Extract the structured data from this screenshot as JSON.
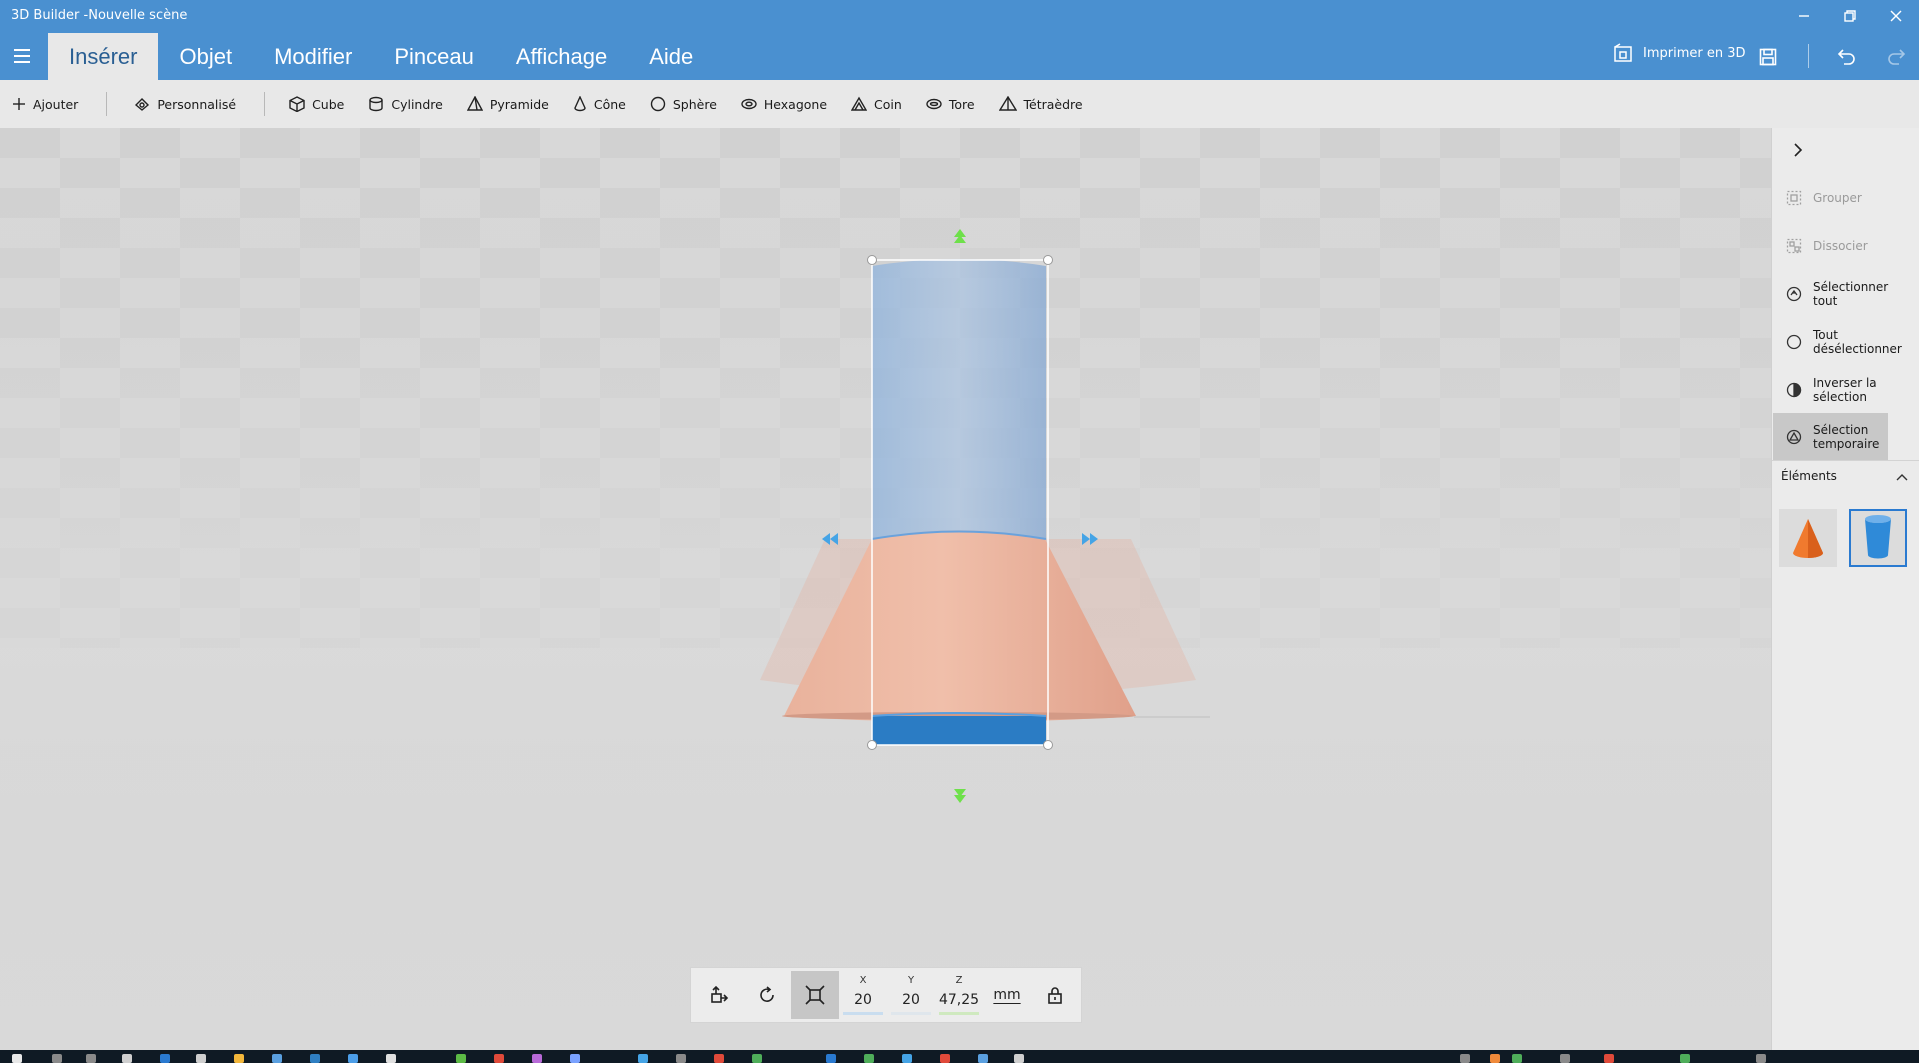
{
  "window": {
    "title": "3D Builder -Nouvelle scène",
    "controls": [
      "minimize-icon",
      "restore-icon",
      "close-icon"
    ]
  },
  "tabs": [
    {
      "label": "Insérer",
      "active": true
    },
    {
      "label": "Objet",
      "active": false
    },
    {
      "label": "Modifier",
      "active": false
    },
    {
      "label": "Pinceau",
      "active": false
    },
    {
      "label": "Affichage",
      "active": false
    },
    {
      "label": "Aide",
      "active": false
    }
  ],
  "toolbar": {
    "print_label": "Imprimer en 3D",
    "icons": [
      "print-3d-icon",
      "save-icon",
      "undo-icon",
      "redo-icon"
    ]
  },
  "ribbon": {
    "add_label": "Ajouter",
    "custom_label": "Personnalisé",
    "shapes": [
      {
        "label": "Cube",
        "icon": "cube-icon"
      },
      {
        "label": "Cylindre",
        "icon": "cylinder-icon"
      },
      {
        "label": "Pyramide",
        "icon": "pyramid-icon"
      },
      {
        "label": "Cône",
        "icon": "cone-icon"
      },
      {
        "label": "Sphère",
        "icon": "sphere-icon"
      },
      {
        "label": "Hexagone",
        "icon": "hexagon-icon"
      },
      {
        "label": "Coin",
        "icon": "wedge-icon"
      },
      {
        "label": "Tore",
        "icon": "torus-icon"
      },
      {
        "label": "Tétraèdre",
        "icon": "tetrahedron-icon"
      }
    ]
  },
  "transform": {
    "x_label": "X",
    "x_value": "20",
    "y_label": "Y",
    "y_value": "20",
    "z_label": "Z",
    "z_value": "47,25",
    "unit": "mm",
    "accent_x": "#9fc6e8",
    "accent_z": "#b7e39a"
  },
  "side_panel": {
    "actions": [
      {
        "label": "Grouper",
        "enabled": false
      },
      {
        "label": "Dissocier",
        "enabled": false
      },
      {
        "label": "Sélectionner tout",
        "enabled": true
      },
      {
        "label": "Tout désélectionner",
        "enabled": true
      },
      {
        "label": "Inverser la sélection",
        "enabled": true
      },
      {
        "label": "Sélection temporaire",
        "enabled": true,
        "active": true
      }
    ],
    "elements_label": "Éléments",
    "elements": [
      {
        "name": "cone",
        "selected": false
      },
      {
        "name": "cylinder",
        "selected": true
      }
    ]
  },
  "colors": {
    "title_bar": "#4a90d0",
    "selection_blue": "#2a7ad0",
    "cone_orange": "#e8a58c",
    "handle_green": "#6ee04a",
    "handle_blue": "#45a4e6"
  }
}
